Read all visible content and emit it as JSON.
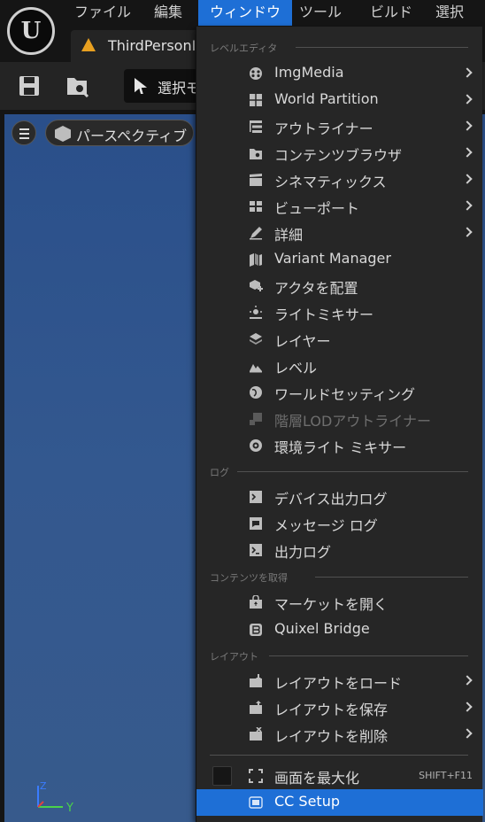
{
  "menubar": {
    "items": [
      "ファイル",
      "編集",
      "ウィンドウ",
      "ツール",
      "ビルド",
      "選択"
    ],
    "active_index": 2
  },
  "tab": {
    "label": "ThirdPersonI"
  },
  "toolbar": {
    "select_mode_label": "選択モ"
  },
  "viewport": {
    "perspective_label": "パースペクティブ",
    "axis_y": "Y",
    "axis_z": "Z"
  },
  "dropdown": {
    "sections": [
      {
        "heading": "レベルエディタ",
        "items": [
          {
            "label": "ImgMedia",
            "icon": "imgmedia-icon",
            "submenu": true
          },
          {
            "label": "World Partition",
            "icon": "world-partition-icon",
            "submenu": true
          },
          {
            "label": "アウトライナー",
            "icon": "outliner-icon",
            "submenu": true
          },
          {
            "label": "コンテンツブラウザ",
            "icon": "content-browser-icon",
            "submenu": true
          },
          {
            "label": "シネマティックス",
            "icon": "clapperboard-icon",
            "submenu": true
          },
          {
            "label": "ビューポート",
            "icon": "viewport-icon",
            "submenu": true
          },
          {
            "label": "詳細",
            "icon": "details-pencil-icon",
            "submenu": true
          },
          {
            "label": "Variant Manager",
            "icon": "variant-manager-icon",
            "submenu": false
          },
          {
            "label": "アクタを配置",
            "icon": "place-actor-icon",
            "submenu": false
          },
          {
            "label": "ライトミキサー",
            "icon": "light-mixer-icon",
            "submenu": false
          },
          {
            "label": "レイヤー",
            "icon": "layers-icon",
            "submenu": false
          },
          {
            "label": "レベル",
            "icon": "levels-icon",
            "submenu": false
          },
          {
            "label": "ワールドセッティング",
            "icon": "world-settings-icon",
            "submenu": false
          },
          {
            "label": "階層LODアウトライナー",
            "icon": "hlod-icon",
            "submenu": false,
            "disabled": true
          },
          {
            "label": "環境ライト ミキサー",
            "icon": "env-light-mixer-icon",
            "submenu": false
          }
        ]
      },
      {
        "heading": "ログ",
        "items": [
          {
            "label": "デバイス出力ログ",
            "icon": "device-log-icon",
            "submenu": false
          },
          {
            "label": "メッセージ ログ",
            "icon": "message-log-icon",
            "submenu": false
          },
          {
            "label": "出力ログ",
            "icon": "output-log-icon",
            "submenu": false
          }
        ]
      },
      {
        "heading": "コンテンツを取得",
        "items": [
          {
            "label": "マーケットを開く",
            "icon": "marketplace-icon",
            "submenu": false
          },
          {
            "label": "Quixel Bridge",
            "icon": "quixel-bridge-icon",
            "submenu": false
          }
        ]
      },
      {
        "heading": "レイアウト",
        "items": [
          {
            "label": "レイアウトをロード",
            "icon": "load-layout-icon",
            "submenu": true
          },
          {
            "label": "レイアウトを保存",
            "icon": "save-layout-icon",
            "submenu": true
          },
          {
            "label": "レイアウトを削除",
            "icon": "remove-layout-icon",
            "submenu": true
          }
        ]
      }
    ],
    "footer": {
      "maximize_label": "画面を最大化",
      "maximize_shortcut": "SHIFT+F11",
      "maximize_checked": false,
      "cc_setup_label": "CC Setup"
    }
  },
  "colors": {
    "accent": "#1e6fd6",
    "menu_bg": "#262626",
    "viewport_sky": "#33588f"
  }
}
